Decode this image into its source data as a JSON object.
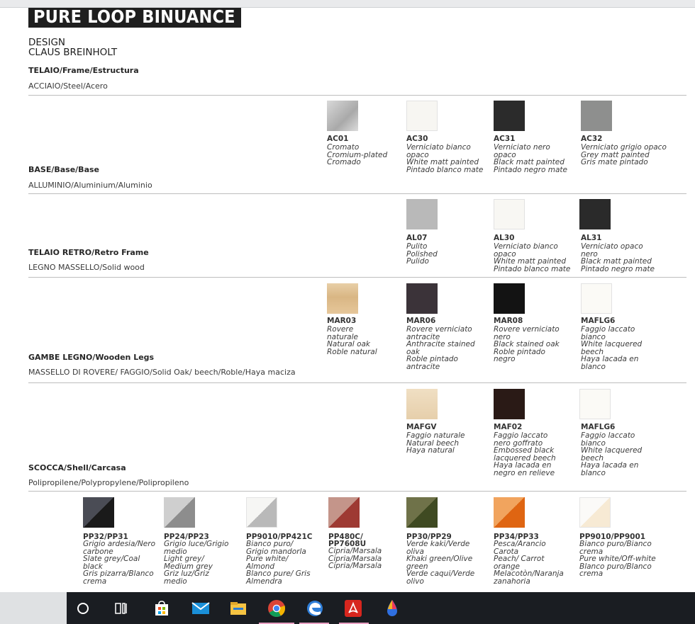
{
  "title": "PURE LOOP BINUANCE",
  "design": [
    "DESIGN",
    "CLAUS BREINHOLT"
  ],
  "telaio": {
    "label": "TELAIO/Frame/Estructura",
    "sub": "ACCIAIO/Steel/Acero"
  },
  "sections": [
    {
      "label": "BASE/Base/Base",
      "sub": "ALLUMINIO/Aluminium/Aluminio",
      "swatches": [
        {
          "code": "AC01",
          "desc": "Cromato\nCromium-plated\nCromado",
          "color": "#c9c9c9"
        },
        {
          "code": "AC30",
          "desc": "Verniciato bianco\nopaco\nWhite matt painted\nPintado blanco mate",
          "color": "#f7f6f2"
        },
        {
          "code": "AC31",
          "desc": "Verniciato nero\nopaco\nBlack matt painted\nPintado negro mate",
          "color": "#2b2b2b"
        },
        {
          "code": "AC32",
          "desc": "Verniciato grigio opaco\nGrey matt painted\nGris mate pintado",
          "color": "#8e8f8e"
        }
      ]
    },
    {
      "label": "TELAIO RETRO/Retro Frame",
      "sub": "LEGNO MASSELLO/Solid wood",
      "swatches": [
        {
          "code": "AL07",
          "desc": "Pulito\nPolished\nPulido",
          "color": "#b9b9b9"
        },
        {
          "code": "AL30",
          "desc": "Verniciato bianco\nopaco\nWhite matt painted\nPintado blanco mate",
          "color": "#f8f7f3"
        },
        {
          "code": "AL31",
          "desc": "Verniciato opaco\nnero\nBlack matt painted\nPintado negro mate",
          "color": "#2a2a2a"
        }
      ]
    },
    {
      "label": "GAMBE LEGNO/Wooden Legs",
      "sub": "MASSELLO DI ROVERE/ FAGGIO/Solid Oak/ beech/Roble/Haya maciza",
      "swatches": [
        {
          "code": "MAR03",
          "desc": "Rovere\nnaturale\nNatural oak\nRoble natural",
          "color": "#e2c49b"
        },
        {
          "code": "MAR06",
          "desc": "Rovere verniciato\nantracite\nAnthracite stained\noak\nRoble pintado\nantracite",
          "color": "#3b3339"
        },
        {
          "code": "MAR08",
          "desc": "Rovere verniciato\nnero\nBlack stained oak\nRoble pintado\nnegro",
          "color": "#131313"
        },
        {
          "code": "MAFLG6",
          "desc": "Faggio laccato\nbianco\nWhite lacquered\nbeech\nHaya lacada en\nblanco",
          "color": "#fbfaf6"
        }
      ]
    },
    {
      "label": "SCOCCA/Shell/Carcasa",
      "sub": "Polipropilene/Polypropylene/Polipropileno",
      "swatches": [
        {
          "code": "MAFGV",
          "desc": "Faggio naturale\nNatural beech\nHaya natural",
          "color": "#ecd9bb"
        },
        {
          "code": "MAF02",
          "desc": "Faggio laccato\nnero goffrato\nEmbossed black\nlacquered beech\nHaya lacada en\nnegro en relieve",
          "color": "#2a1a16"
        },
        {
          "code": "MAFLG6",
          "desc": "Faggio laccato\nbianco\nWhite lacquered\nbeech\nHaya lacada en\nblanco",
          "color": "#fbfaf6"
        }
      ]
    }
  ],
  "shell_colors": [
    {
      "code": "PP32/PP31",
      "desc": "Grigio ardesia/Nero\ncarbone\nSlate grey/Coal\nblack\nGris pizarra/Blanco\ncrema",
      "c1": "#4a4c55",
      "c2": "#1a1a1a"
    },
    {
      "code": "PP24/PP23",
      "desc": "Grigio luce/Grigio\nmedio\nLight grey/\nMedium grey\nGriz luz/Griz\nmedio",
      "c1": "#cfcfcf",
      "c2": "#8d8d8d"
    },
    {
      "code": "PP9010/PP421C",
      "desc": "Bianco puro/\nGrigio mandorla\nPure white/\nAlmond\nBlanco pure/ Gris\nAlmendra",
      "c1": "#f6f6f4",
      "c2": "#b9b9b9"
    },
    {
      "code": "PP480C/\nPP7608U",
      "desc": "Cipria/Marsala\nCipria/Marsala\nCipria/Marsala",
      "c1": "#c4958a",
      "c2": "#9e3a33"
    },
    {
      "code": "PP30/PP29",
      "desc": "Verde kaki/Verde\noliva\nKhaki green/Olive\ngreen\nVerde caqui/Verde\nolivo",
      "c1": "#6f7249",
      "c2": "#3f4a22"
    },
    {
      "code": "PP34/PP33",
      "desc": "Pesca/Arancio\nCarota\nPeach/ Carrot\norange\nMelacotòn/Naranja\nzanahoria",
      "c1": "#f1a45e",
      "c2": "#df6512"
    },
    {
      "code": "PP9010/PP9001",
      "desc": "Bianco puro/Bianco\ncrema\nPure white/Off-white\nBlanco puro/Blanco\ncrema",
      "c1": "#fbfaf8",
      "c2": "#f7ead4"
    }
  ],
  "taskbar": {
    "icons": [
      "search-circle-icon",
      "task-view-icon",
      "store-icon",
      "mail-icon",
      "file-explorer-icon",
      "chrome-icon",
      "edge-icon",
      "acrobat-icon",
      "paint-drop-icon"
    ]
  }
}
